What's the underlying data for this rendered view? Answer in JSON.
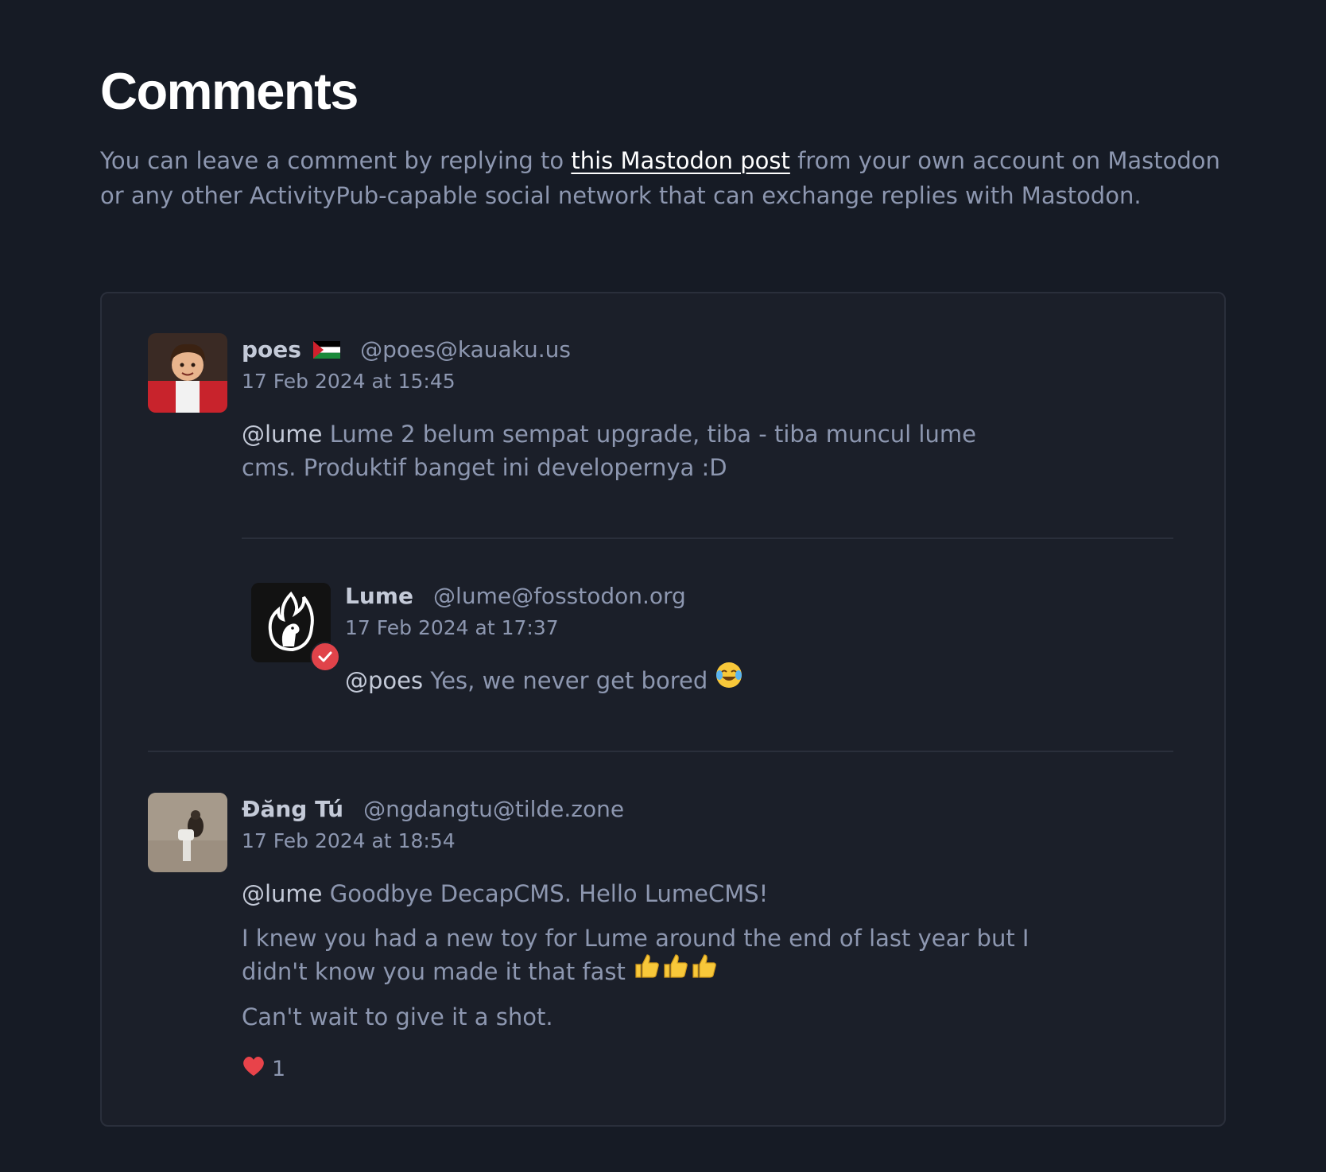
{
  "page": {
    "title": "Comments",
    "intro_before": "You can leave a comment by replying to ",
    "intro_link": "this Mastodon post",
    "intro_after": " from your own account on Mastodon or any other ActivityPub-capable social network that can exchange replies with Mastodon."
  },
  "comments": [
    {
      "author": "poes",
      "author_flag_icon": "palestine-flag-icon",
      "handle": "@poes@kauaku.us",
      "date": "17 Feb 2024 at 15:45",
      "mention": "@lume",
      "text": " Lume 2 belum sempat upgrade, tiba - tiba muncul lume cms. Produktif banget ini developernya :D"
    },
    {
      "author": "Lume",
      "handle": "@lume@fosstodon.org",
      "date": "17 Feb 2024 at 17:37",
      "mention": "@poes",
      "text": " Yes, we never get bored ",
      "emoji_icon": "tears-of-joy-icon",
      "verified_icon": "verified-check-icon"
    },
    {
      "author": "Đăng Tú",
      "handle": "@ngdangtu@tilde.zone",
      "date": "17 Feb 2024 at 18:54",
      "mention": "@lume",
      "paragraph1": " Goodbye DecapCMS. Hello LumeCMS!",
      "paragraph2": "I knew you had a new toy for Lume around the end of last year but I didn't know you made it that fast ",
      "paragraph2_emoji": "thumbs-up-icon x3",
      "paragraph3": "Can't wait to give it a shot.",
      "likes": "1",
      "likes_icon": "heart-icon"
    }
  ],
  "colors": {
    "background": "#161b25",
    "card": "#1b1f29",
    "text": "#8d97b0",
    "heading": "#ffffff",
    "accent_red": "#e0434a"
  }
}
